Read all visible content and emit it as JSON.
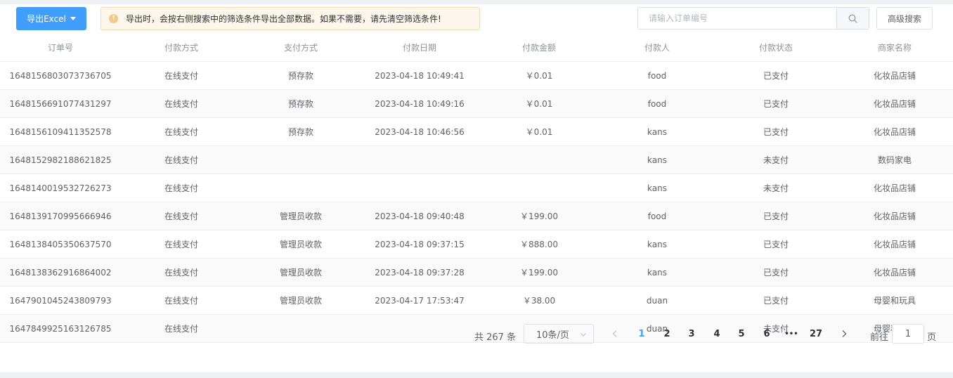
{
  "toolbar": {
    "export_label": "导出Excel",
    "alert_text": "导出时，会按右侧搜索中的筛选条件导出全部数据。如果不需要，请先清空筛选条件!",
    "search_placeholder": "请输入订单编号",
    "advanced_search_label": "高级搜索"
  },
  "table": {
    "headers": [
      "订单号",
      "付款方式",
      "支付方式",
      "付款日期",
      "付款金额",
      "付款人",
      "付款状态",
      "商家名称"
    ],
    "rows": [
      [
        "1648156803073736705",
        "在线支付",
        "预存款",
        "2023-04-18 10:49:41",
        "￥0.01",
        "food",
        "已支付",
        "化妆品店铺"
      ],
      [
        "1648156691077431297",
        "在线支付",
        "预存款",
        "2023-04-18 10:49:16",
        "￥0.01",
        "food",
        "已支付",
        "化妆品店铺"
      ],
      [
        "1648156109411352578",
        "在线支付",
        "预存款",
        "2023-04-18 10:46:56",
        "￥0.01",
        "kans",
        "已支付",
        "化妆品店铺"
      ],
      [
        "1648152982188621825",
        "在线支付",
        "",
        "",
        "",
        "kans",
        "未支付",
        "数码家电"
      ],
      [
        "1648140019532726273",
        "在线支付",
        "",
        "",
        "",
        "kans",
        "未支付",
        "化妆品店铺"
      ],
      [
        "1648139170995666946",
        "在线支付",
        "管理员收款",
        "2023-04-18 09:40:48",
        "￥199.00",
        "food",
        "已支付",
        "化妆品店铺"
      ],
      [
        "1648138405350637570",
        "在线支付",
        "管理员收款",
        "2023-04-18 09:37:15",
        "￥888.00",
        "kans",
        "已支付",
        "化妆品店铺"
      ],
      [
        "1648138362916864002",
        "在线支付",
        "管理员收款",
        "2023-04-18 09:37:28",
        "￥199.00",
        "kans",
        "已支付",
        "化妆品店铺"
      ],
      [
        "1647901045243809793",
        "在线支付",
        "管理员收款",
        "2023-04-17 17:53:47",
        "￥38.00",
        "duan",
        "已支付",
        "母婴和玩具"
      ],
      [
        "1647849925163126785",
        "在线支付",
        "",
        "",
        "",
        "duan",
        "未支付",
        "母婴和玩具"
      ]
    ]
  },
  "pagination": {
    "total_text": "共 267 条",
    "page_size": "10条/页",
    "pages": [
      "1",
      "2",
      "3",
      "4",
      "5",
      "6",
      "•••",
      "27"
    ],
    "current_page": "1",
    "goto_label": "前往",
    "goto_value": "1",
    "goto_suffix": "页"
  },
  "colors": {
    "primary": "#409eff",
    "warning": "#e6a23c",
    "warning_bg": "#fdf6ec"
  },
  "icons": {
    "export_caret": "caret-down-icon",
    "alert": "info-icon",
    "search": "search-icon",
    "select": "chevron-down-icon",
    "prev": "chevron-left-icon",
    "next": "chevron-right-icon"
  }
}
